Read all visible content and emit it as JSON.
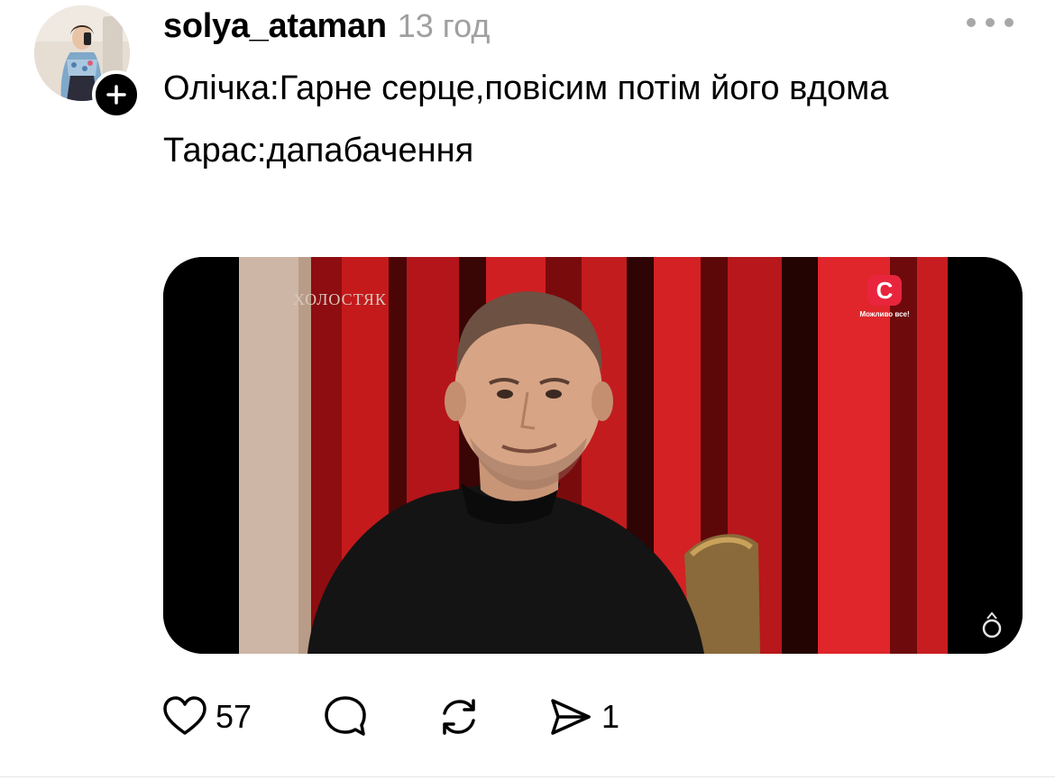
{
  "post": {
    "username": "solya_ataman",
    "timestamp": "13 год",
    "text_lines": [
      "Олічка:Гарне серце,повісим потім його вдома",
      "Тарас:дапабачення"
    ]
  },
  "media": {
    "show_logo": "ХОЛОСТЯК",
    "channel_logo_letter": "С",
    "channel_slogan": "Можливо все!"
  },
  "actions": {
    "like_count": "57",
    "share_count": "1"
  },
  "icons": {
    "follow": "plus-icon",
    "more": "more-dots-icon",
    "like": "heart-icon",
    "comment": "comment-bubble-icon",
    "repost": "repost-icon",
    "share": "send-icon"
  },
  "colors": {
    "text": "#000000",
    "muted": "#a0a0a0",
    "channel_red": "#e8253d"
  }
}
